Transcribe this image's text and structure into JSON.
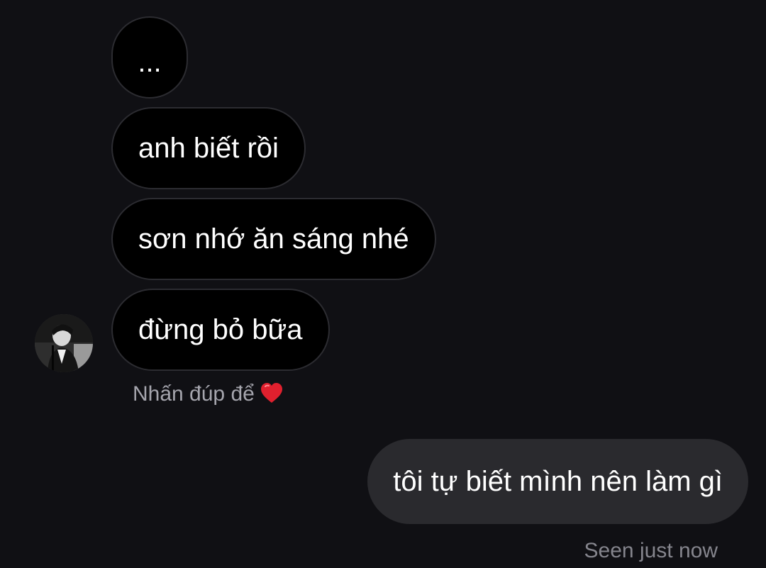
{
  "conversation": {
    "incoming": [
      {
        "text": "..."
      },
      {
        "text": "anh biết rồi"
      },
      {
        "text": "sơn nhớ ăn sáng nhé"
      },
      {
        "text": "đừng bỏ bữa"
      }
    ],
    "double_tap_hint": "Nhấn đúp để",
    "reaction_icon": "red-heart",
    "outgoing": [
      {
        "text": "tôi tự biết mình nên làm gì"
      }
    ],
    "seen_status": "Seen just now"
  },
  "colors": {
    "background": "#101014",
    "incoming_bubble": "#000000",
    "incoming_border": "#2c2c31",
    "outgoing_bubble": "#2a2a2e",
    "hint_text": "#a5a5ad",
    "heart": "#e0202e"
  }
}
